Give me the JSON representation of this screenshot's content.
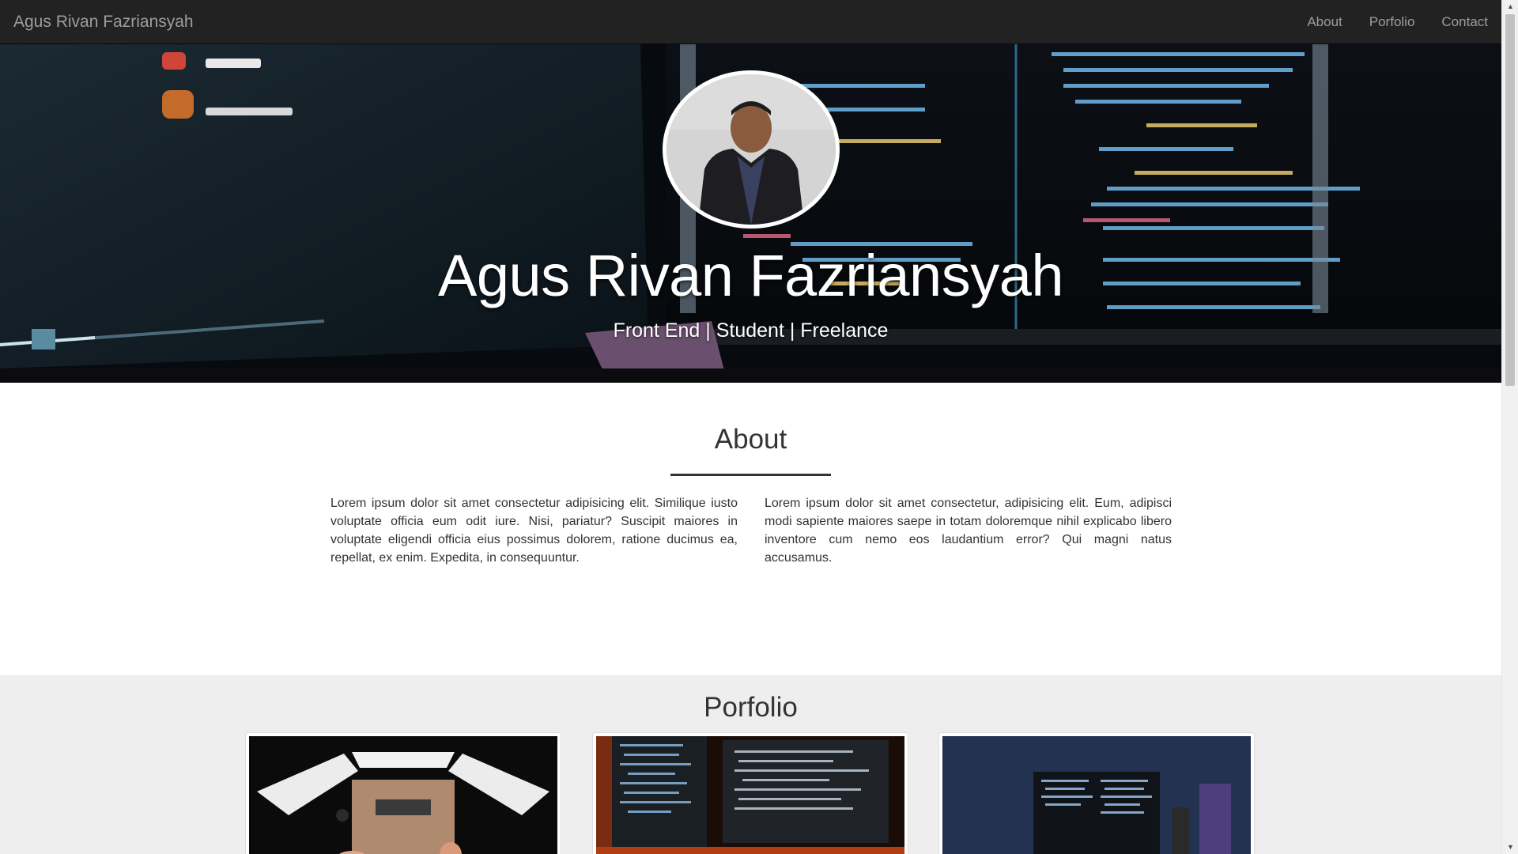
{
  "navbar": {
    "brand": "Agus Rivan Fazriansyah",
    "links": [
      "About",
      "Porfolio",
      "Contact"
    ]
  },
  "hero": {
    "name": "Agus Rivan Fazriansyah",
    "tagline": "Front End | Student | Freelance"
  },
  "about": {
    "title": "About",
    "paragraph_left": "Lorem ipsum dolor sit amet consectetur adipisicing elit. Similique iusto voluptate officia eum odit iure. Nisi, pariatur? Suscipit maiores in voluptate eligendi officia eius possimus dolorem, ratione ducimus ea, repellat, ex enim. Expedita, in consequuntur.",
    "paragraph_right": "Lorem ipsum dolor sit amet consectetur, adipisicing elit. Eum, adipisci modi sapiente maiores saepe in totam doloremque nihil explicabo libero inventore cum nemo eos laudantium error? Qui magni natus accusamus."
  },
  "portfolio": {
    "title": "Porfolio"
  },
  "colors": {
    "navbar_bg": "#222222",
    "nav_text": "#9d9d9d",
    "portfolio_bg": "#eeeeee"
  }
}
